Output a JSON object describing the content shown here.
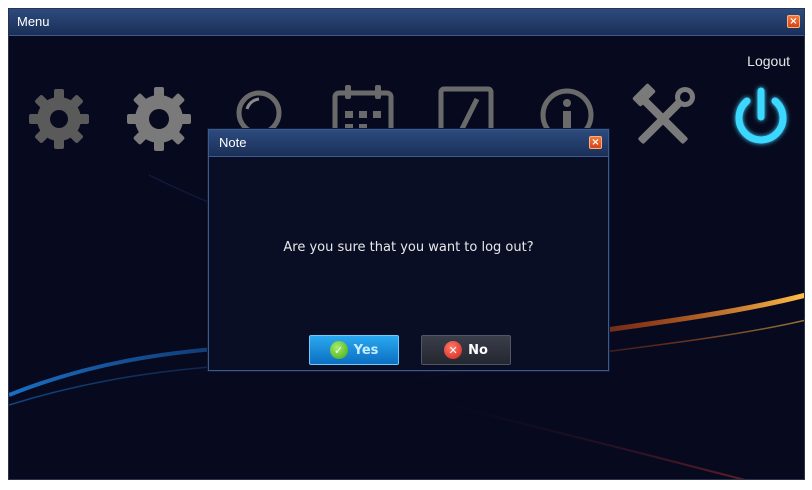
{
  "window": {
    "title": "Menu",
    "close_glyph": "×"
  },
  "toolbar": {
    "logout_label": "Logout",
    "icons": [
      "gear-icon-disabled",
      "gear-icon",
      "search-icon",
      "calendar-icon",
      "document-icon",
      "info-icon",
      "tools-icon",
      "power-icon"
    ]
  },
  "dialog": {
    "title": "Note",
    "close_glyph": "×",
    "message": "Are you sure that you want to log out?",
    "yes_label": "Yes",
    "no_label": "No",
    "yes_glyph": "✓",
    "no_glyph": "✕"
  },
  "colors": {
    "accent": "#2aa8f0",
    "power_glow": "#3cd8ff",
    "background": "#070a1e"
  }
}
